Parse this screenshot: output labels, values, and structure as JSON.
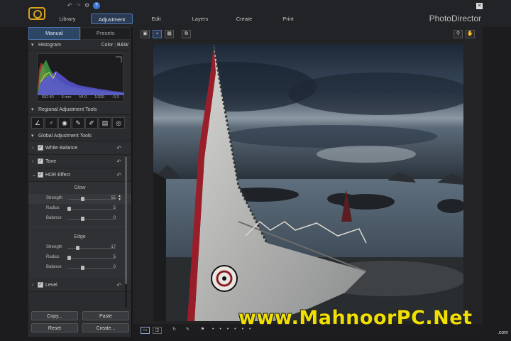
{
  "app": {
    "brand": "PhotoDirector",
    "main_tabs": [
      "Library",
      "Adjustment",
      "Edit",
      "Layers",
      "Create",
      "Print"
    ],
    "active_tab": "Adjustment",
    "help_label": "?"
  },
  "left_panel": {
    "tabs": [
      "Manual",
      "Presets"
    ],
    "active_tab": "Manual",
    "histogram": {
      "title": "Histogram",
      "modes": [
        "Color",
        "B&W"
      ],
      "iso": "ISO 80",
      "focal": "6 mm",
      "aperture": "f/4.0",
      "shutter": "1/320",
      "ev": "-0.3"
    },
    "regional": {
      "title": "Regional Adjustment Tools"
    },
    "global": {
      "title": "Global Adjustment Tools",
      "items": [
        "White Balance",
        "Tone",
        "HDR Effect",
        "Level"
      ],
      "glow": {
        "title": "Glow",
        "sliders": [
          {
            "label": "Strength",
            "value": "55",
            "level": 0.55
          },
          {
            "label": "Radius",
            "value": "5",
            "level": 0.05
          },
          {
            "label": "Balance",
            "value": "0",
            "level": 0.5
          }
        ]
      },
      "edge": {
        "title": "Edge",
        "sliders": [
          {
            "label": "Strength",
            "value": "17",
            "level": 0.4
          },
          {
            "label": "Radius",
            "value": "5",
            "level": 0.05
          },
          {
            "label": "Balance",
            "value": "0",
            "level": 0.5
          }
        ]
      }
    },
    "buttons": {
      "copy": "Copy...",
      "paste": "Paste",
      "reset": "Reset",
      "create": "Create..."
    }
  },
  "watermark": {
    "text": "www.MahnoorPC.Net",
    "small": ".com"
  },
  "colors": {
    "accent": "#4b76b3",
    "watermark": "#f0df00",
    "logo": "#d9a21c"
  }
}
